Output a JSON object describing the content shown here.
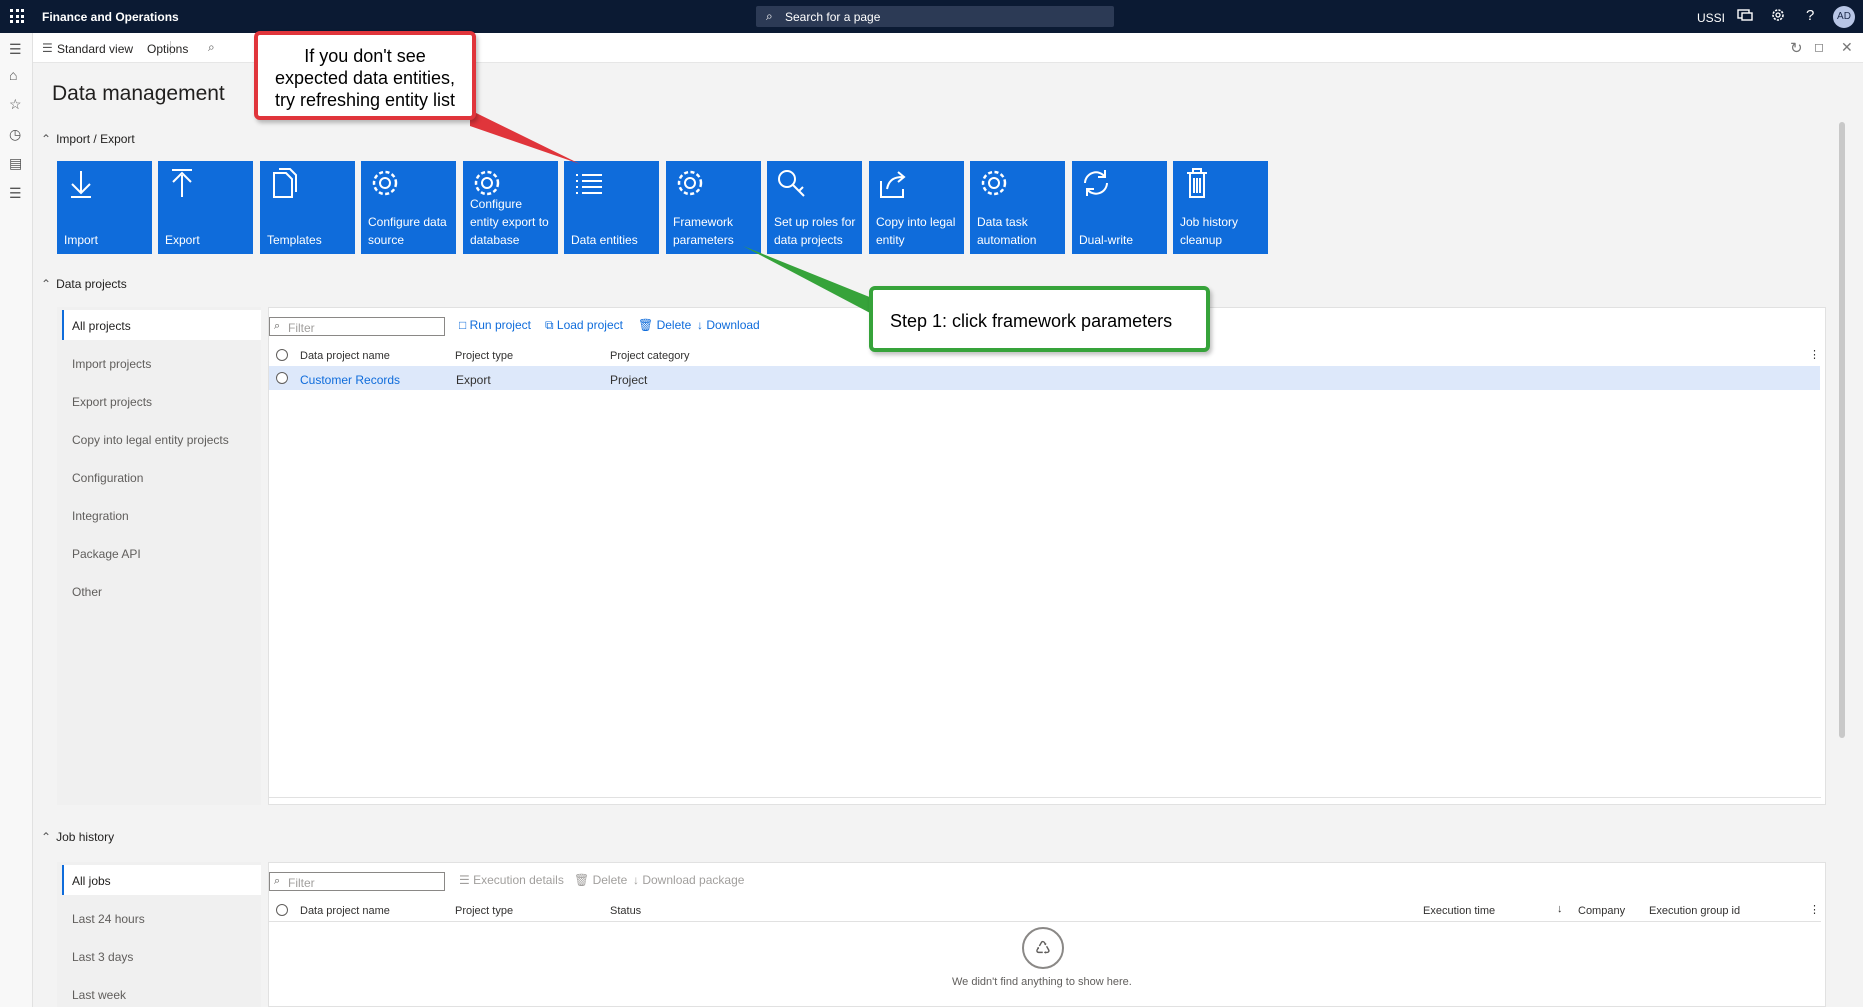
{
  "topbar": {
    "app_title": "Finance and Operations",
    "search_placeholder": "Search for a page",
    "company": "USSI",
    "user_initials": "AD"
  },
  "cmdbar": {
    "standard_view": "Standard view",
    "options": "Options"
  },
  "page": {
    "title": "Data management"
  },
  "import_export": {
    "heading": "Import / Export",
    "tiles": [
      {
        "label": "Import",
        "icon": "download-icon"
      },
      {
        "label": "Export",
        "icon": "upload-icon"
      },
      {
        "label": "Templates",
        "icon": "templates-icon"
      },
      {
        "label": "Configure data source",
        "icon": "gear-icon"
      },
      {
        "label": "Configure entity export to database",
        "icon": "gear-icon"
      },
      {
        "label": "Data entities",
        "icon": "list-icon"
      },
      {
        "label": "Framework parameters",
        "icon": "gear-icon"
      },
      {
        "label": "Set up roles for data projects",
        "icon": "key-icon"
      },
      {
        "label": "Copy into legal entity",
        "icon": "share-icon"
      },
      {
        "label": "Data task automation",
        "icon": "gear-icon"
      },
      {
        "label": "Dual-write",
        "icon": "sync-icon"
      },
      {
        "label": "Job history cleanup",
        "icon": "trash-icon"
      }
    ]
  },
  "data_projects": {
    "heading": "Data projects",
    "side_items": [
      "All projects",
      "Import projects",
      "Export projects",
      "Copy into legal entity projects",
      "Configuration",
      "Integration",
      "Package API",
      "Other"
    ],
    "filter_placeholder": "Filter",
    "actions": {
      "run": "Run project",
      "load": "Load project",
      "delete": "Delete",
      "download": "Download"
    },
    "columns": [
      "Data project name",
      "Project type",
      "Project category"
    ],
    "rows": [
      {
        "name": "Customer Records",
        "type": "Export",
        "category": "Project"
      }
    ]
  },
  "job_history": {
    "heading": "Job history",
    "side_items": [
      "All jobs",
      "Last 24 hours",
      "Last 3 days",
      "Last week"
    ],
    "filter_placeholder": "Filter",
    "actions": {
      "details": "Execution details",
      "delete": "Delete",
      "download": "Download package"
    },
    "columns": {
      "name": "Data project name",
      "type": "Project type",
      "status": "Status",
      "exec_time": "Execution time",
      "company": "Company",
      "group": "Execution group id"
    },
    "empty_text": "We didn't find anything to show here."
  },
  "callouts": {
    "red_lines": [
      "If you don't see",
      "expected data entities,",
      "try refreshing entity list"
    ],
    "green": "Step 1: click framework parameters"
  },
  "colors": {
    "topbar": "#0b1a33",
    "tile": "#0f6cdb",
    "callout_red": "#e0353b",
    "callout_green": "#36a33a"
  }
}
